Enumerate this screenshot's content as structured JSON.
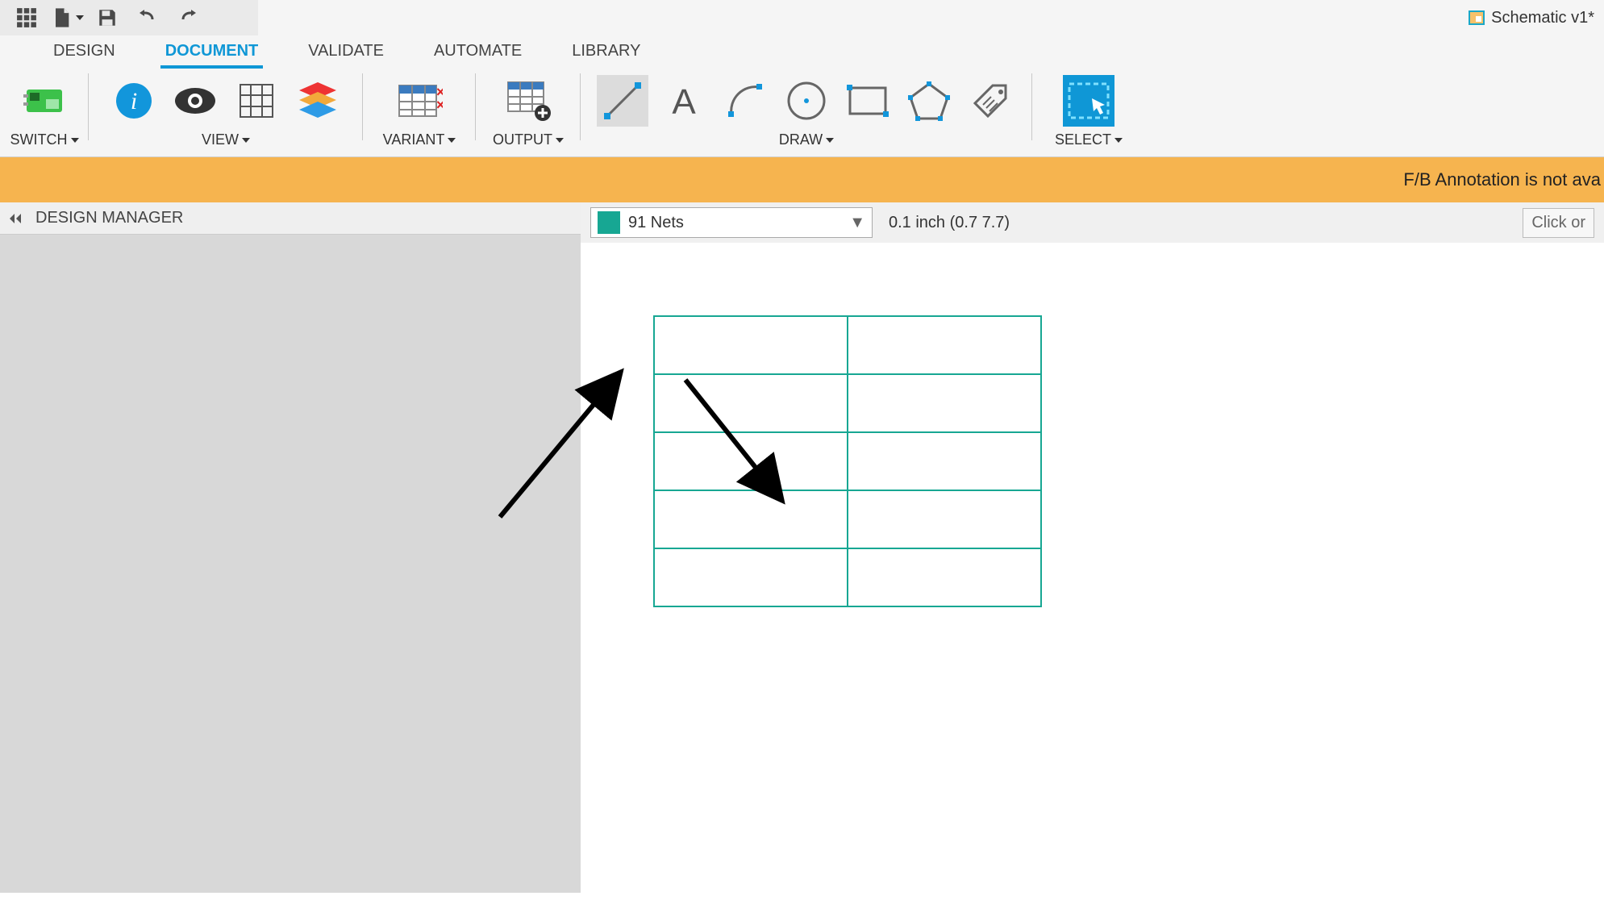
{
  "qat": {
    "schematic_label": "Schematic v1*"
  },
  "tabs": {
    "items": [
      "DESIGN",
      "DOCUMENT",
      "VALIDATE",
      "AUTOMATE",
      "LIBRARY"
    ],
    "active_index": 1
  },
  "ribbon": {
    "switch": "SWITCH",
    "view": "VIEW",
    "variant": "VARIANT",
    "output": "OUTPUT",
    "draw": "DRAW",
    "select": "SELECT"
  },
  "warning": "F/B Annotation is not ava",
  "design_manager": {
    "title": "DESIGN MANAGER"
  },
  "canvas": {
    "layer_label": "91 Nets",
    "coord_text": "0.1 inch (0.7 7.7)",
    "hint_placeholder": "Click or"
  },
  "colors": {
    "accent_blue": "#0f97d6",
    "teal": "#17a793",
    "warn": "#f6b44f"
  }
}
